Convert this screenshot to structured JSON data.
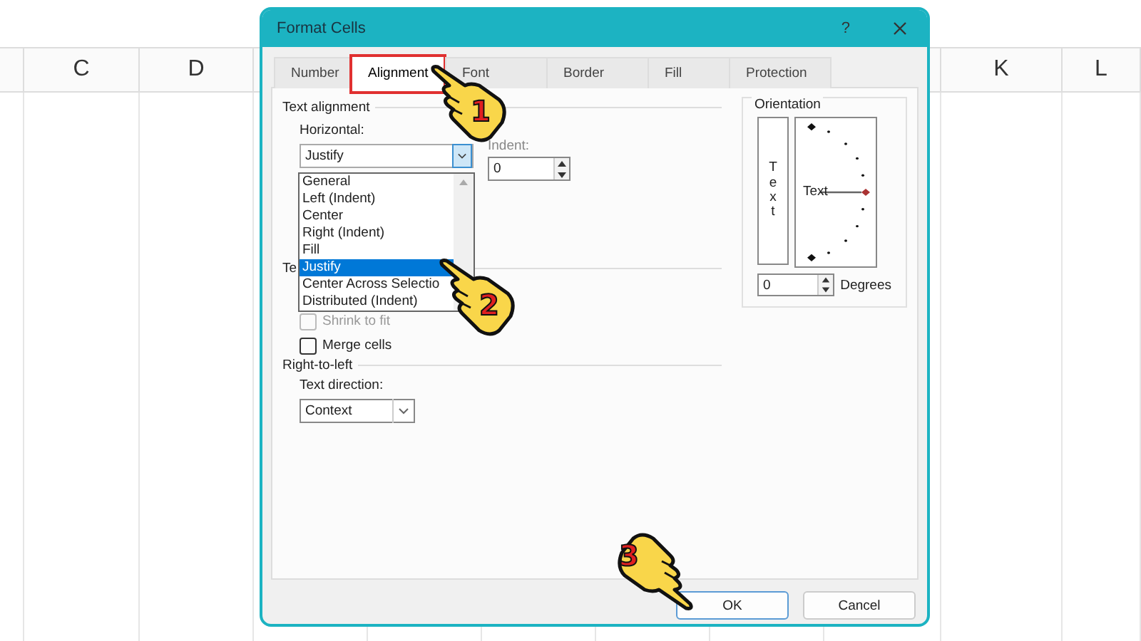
{
  "sheet": {
    "columns": [
      "C",
      "D",
      "K",
      "L"
    ]
  },
  "dialog": {
    "title": "Format Cells",
    "help": "?",
    "tabs": [
      {
        "label": "Number",
        "selected": false,
        "highlighted": false
      },
      {
        "label": "Alignment",
        "selected": true,
        "highlighted": true
      },
      {
        "label": "Font",
        "selected": false,
        "highlighted": false
      },
      {
        "label": "Border",
        "selected": false,
        "highlighted": false
      },
      {
        "label": "Fill",
        "selected": false,
        "highlighted": false
      },
      {
        "label": "Protection",
        "selected": false,
        "highlighted": false
      }
    ],
    "text_alignment": {
      "heading": "Text alignment",
      "horizontal_label": "Horizontal:",
      "horizontal_value": "Justify",
      "indent_label": "Indent:",
      "indent_value": "0",
      "options": [
        {
          "label": "General",
          "selected": false
        },
        {
          "label": "Left (Indent)",
          "selected": false
        },
        {
          "label": "Center",
          "selected": false
        },
        {
          "label": "Right (Indent)",
          "selected": false
        },
        {
          "label": "Fill",
          "selected": false
        },
        {
          "label": "Justify",
          "selected": true
        },
        {
          "label": "Center Across Selectio",
          "selected": false
        },
        {
          "label": "Distributed (Indent)",
          "selected": false
        }
      ]
    },
    "text_control": {
      "heading": "Te",
      "checkboxes": [
        {
          "label": "Shrink to fit",
          "checked": false,
          "disabled": true
        },
        {
          "label": "Merge cells",
          "checked": false,
          "disabled": false
        }
      ]
    },
    "right_to_left": {
      "heading": "Right-to-left",
      "direction_label": "Text direction:",
      "direction_value": "Context"
    },
    "orientation": {
      "heading": "Orientation",
      "vertical_text": "Text",
      "dial_text": "Text",
      "degrees_value": "0",
      "degrees_label": "Degrees"
    },
    "buttons": [
      {
        "label": "OK",
        "default": true
      },
      {
        "label": "Cancel",
        "default": false
      }
    ]
  },
  "callouts": [
    {
      "number": "1"
    },
    {
      "number": "2"
    },
    {
      "number": "3"
    }
  ]
}
